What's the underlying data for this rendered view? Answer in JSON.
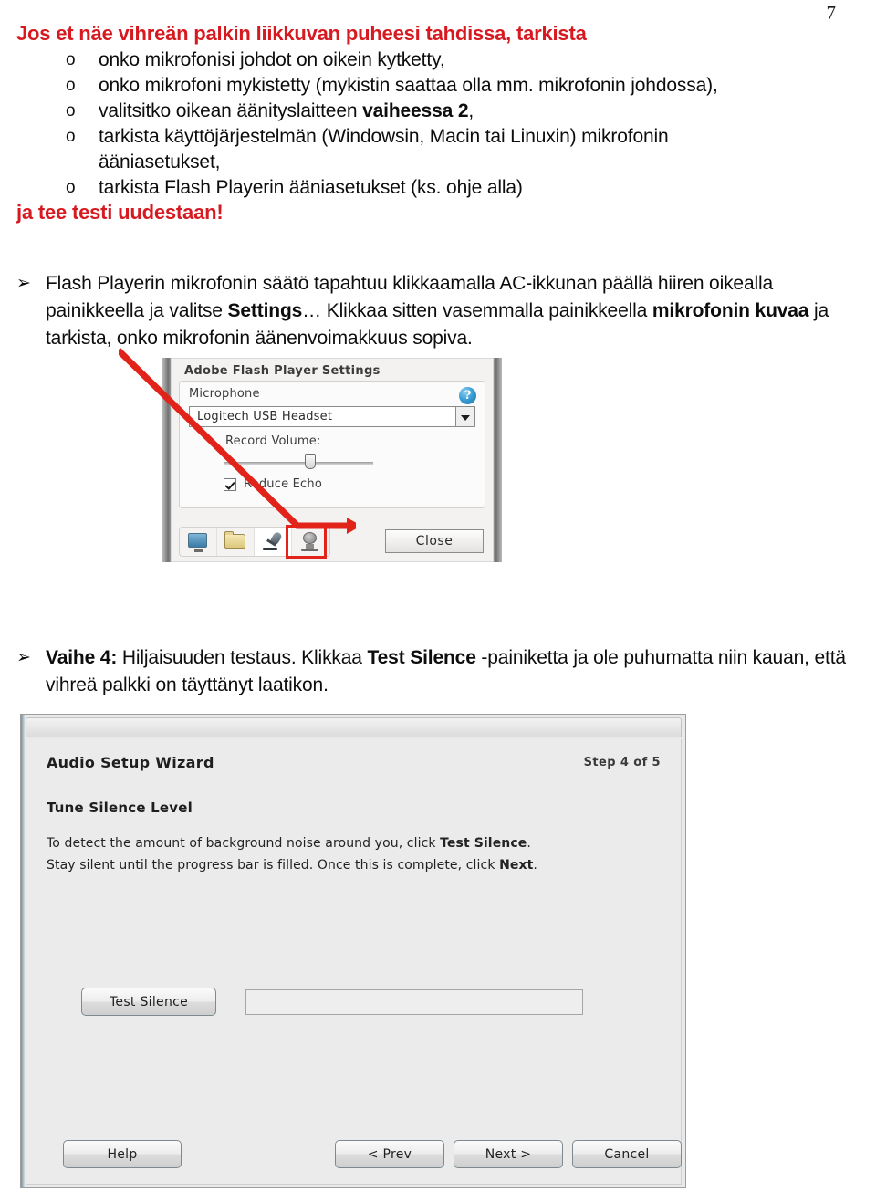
{
  "page": {
    "number": "7"
  },
  "heading": {
    "red_top": "Jos et näe vihreän palkin liikkuvan puheesi tahdissa, tarkista",
    "red_bottom": "ja tee testi uudestaan!"
  },
  "checklist": {
    "bullet_glyph": "o",
    "items": [
      "onko mikrofonisi johdot on oikein kytketty,",
      "onko mikrofoni mykistetty (mykistin saattaa olla mm. mikrofonin johdossa),",
      "valitsitko oikean äänityslaitteen vaiheessa 2,",
      "tarkista käyttöjärjestelmän (Windowsin, Macin tai Linuxin) mikrofonin ääniasetukset,",
      "tarkista Flash Playerin ääniasetukset (ks. ohje alla)"
    ],
    "item3_plain_prefix": "valitsitko oikean äänityslaitteen ",
    "item3_bold": "vaiheessa 2",
    "item3_suffix": ",",
    "item4_line1": "tarkista käyttöjärjestelmän (Windowsin, Macin tai Linuxin) mikrofonin",
    "item4_line2": "ääniasetukset,"
  },
  "paragraphs": {
    "arrow_glyph": "➢",
    "flash": {
      "part1": "Flash Playerin mikrofonin säätö tapahtuu klikkaamalla AC-ikkunan päällä hiiren oikealla painikkeella ja valitse ",
      "bold1": "Settings",
      "part2": "… Klikkaa sitten vasemmalla painikkeella ",
      "bold2": "mikrofonin kuvaa",
      "part3": " ja tarkista, onko mikrofonin äänenvoimakkuus sopiva."
    },
    "vaihe": {
      "bold1": "Vaihe 4:",
      "part1": " Hiljaisuuden testaus. Klikkaa ",
      "bold2": "Test Silence",
      "part2": " -painiketta ja ole puhumatta niin kauan, että vihreä palkki on täyttänyt laatikon."
    }
  },
  "flash_dialog": {
    "title": "Adobe Flash Player Settings",
    "microphone_label": "Microphone",
    "help_glyph": "?",
    "device_selected": "Logitech USB Headset",
    "record_volume_label": "Record Volume:",
    "reduce_echo_label": "Reduce Echo",
    "reduce_echo_checked": true,
    "close_label": "Close",
    "tabs": [
      {
        "name": "display-tab",
        "selected": false
      },
      {
        "name": "local-storage-tab",
        "selected": false
      },
      {
        "name": "microphone-tab",
        "selected": true
      },
      {
        "name": "camera-tab",
        "selected": false
      }
    ],
    "highlight_color": "#e2231a"
  },
  "wizard": {
    "title": "Audio Setup Wizard",
    "step": "Step 4 of 5",
    "section_title": "Tune Silence Level",
    "line1_a": "To detect the amount of background noise around you, click ",
    "line1_bold": "Test Silence",
    "line1_b": ".",
    "line2_a": "Stay silent until the progress bar is filled. Once this is complete, click ",
    "line2_bold": "Next",
    "line2_b": ".",
    "test_silence_label": "Test Silence",
    "progress_value": "",
    "buttons": {
      "help": "Help",
      "prev": "< Prev",
      "next": "Next >",
      "cancel": "Cancel"
    }
  },
  "colors": {
    "accent_red": "#d71920",
    "highlight_red": "#e2231a",
    "text": "#0d0d0d"
  }
}
